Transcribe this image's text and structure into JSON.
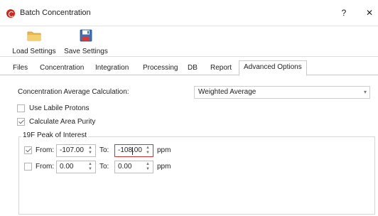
{
  "window": {
    "title": "Batch Concentration",
    "help_label": "?",
    "close_label": "✕"
  },
  "toolbar": {
    "load_label": "Load Settings",
    "save_label": "Save Settings"
  },
  "tabs": [
    {
      "label": "Files"
    },
    {
      "label": "Concentration"
    },
    {
      "label": "Integration"
    },
    {
      "label": "Processing"
    },
    {
      "label": "DB"
    },
    {
      "label": "Report"
    },
    {
      "label": "Advanced Options",
      "active": true
    }
  ],
  "options": {
    "avg_calc_label": "Concentration Average Calculation:",
    "avg_calc_value": "Weighted Average",
    "use_labile_label": "Use Labile Protons",
    "use_labile_checked": false,
    "calc_area_label": "Calculate Area Purity",
    "calc_area_checked": true
  },
  "peak_group": {
    "title": "19F Peak of Interest",
    "rows": [
      {
        "checked": true,
        "from_label": "From:",
        "from_value": "-107.00",
        "to_label": "To:",
        "to_value": "-108.00",
        "unit": "ppm"
      },
      {
        "checked": false,
        "from_label": "From:",
        "from_value": "0.00",
        "to_label": "To:",
        "to_value": "0.00",
        "unit": "ppm"
      }
    ]
  }
}
